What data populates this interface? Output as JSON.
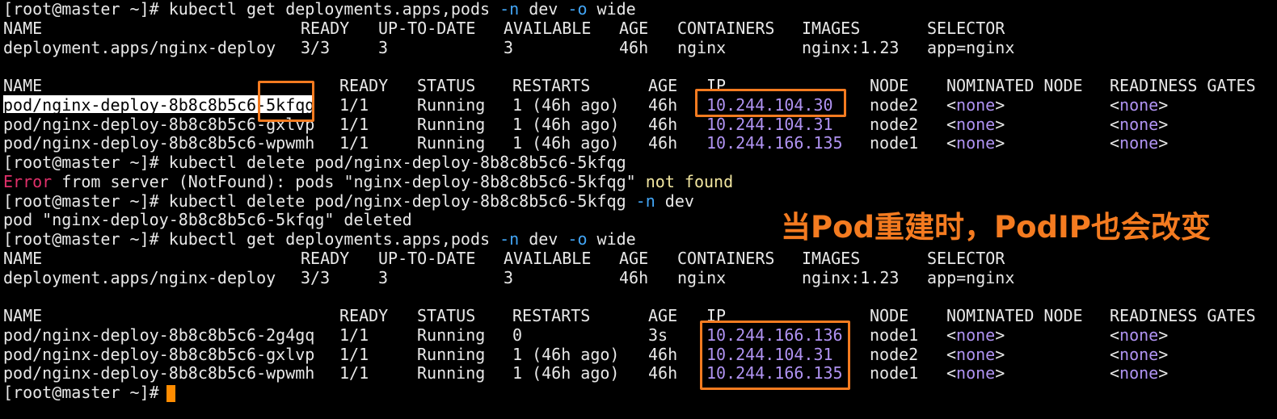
{
  "lines": [
    {
      "segs": [
        {
          "t": "[root@master ~]# kubectl get deployments.apps,pods "
        },
        {
          "t": "-n",
          "c": "blue"
        },
        {
          "t": " dev "
        },
        {
          "t": "-o",
          "c": "blue"
        },
        {
          "t": " wide"
        }
      ]
    },
    {
      "cols": [
        "NAME",
        "READY",
        "UP-TO-DATE",
        "AVAILABLE",
        "AGE",
        "CONTAINERS",
        "IMAGES",
        "SELECTOR"
      ]
    },
    {
      "cols": [
        "deployment.apps/nginx-deploy",
        "3/3",
        "3",
        "3",
        "46h",
        "nginx",
        "nginx:1.23",
        "app=nginx"
      ]
    },
    {
      "empty": true
    },
    {
      "cols": [
        "NAME",
        "READY",
        "STATUS",
        "RESTARTS",
        "AGE",
        "IP",
        "NODE",
        "NOMINATED NODE",
        "READINESS GATES"
      ]
    },
    {
      "cols": [
        "pod/nginx-deploy-8b8c8b5c6-5kfqg",
        "1/1",
        "Running",
        "1 (46h ago)",
        "46h",
        "10.244.104.30",
        "node2",
        "<none>",
        "<none>"
      ],
      "hl": true
    },
    {
      "cols": [
        "pod/nginx-deploy-8b8c8b5c6-gxlvp",
        "1/1",
        "Running",
        "1 (46h ago)",
        "46h",
        "10.244.104.31",
        "node2",
        "<none>",
        "<none>"
      ]
    },
    {
      "cols": [
        "pod/nginx-deploy-8b8c8b5c6-wpwmh",
        "1/1",
        "Running",
        "1 (46h ago)",
        "46h",
        "10.244.166.135",
        "node1",
        "<none>",
        "<none>"
      ]
    },
    {
      "segs": [
        {
          "t": "[root@master ~]# kubectl delete pod/nginx-deploy-8b8c8b5c6-5kfqg"
        }
      ]
    },
    {
      "segs": [
        {
          "t": "Error",
          "c": "red"
        },
        {
          "t": " from server (NotFound): pods \"nginx-deploy-8b8c8b5c6-5kfqg\" "
        },
        {
          "t": "not found",
          "c": "yellow"
        }
      ]
    },
    {
      "segs": [
        {
          "t": "[root@master ~]# kubectl delete pod/nginx-deploy-8b8c8b5c6-5kfqg "
        },
        {
          "t": "-n",
          "c": "blue"
        },
        {
          "t": " dev"
        }
      ]
    },
    {
      "segs": [
        {
          "t": "pod \"nginx-deploy-8b8c8b5c6-5kfqg\" deleted"
        }
      ]
    },
    {
      "segs": [
        {
          "t": "[root@master ~]# kubectl get deployments.apps,pods "
        },
        {
          "t": "-n",
          "c": "blue"
        },
        {
          "t": " dev "
        },
        {
          "t": "-o",
          "c": "blue"
        },
        {
          "t": " wide"
        }
      ]
    },
    {
      "cols": [
        "NAME",
        "READY",
        "UP-TO-DATE",
        "AVAILABLE",
        "AGE",
        "CONTAINERS",
        "IMAGES",
        "SELECTOR"
      ]
    },
    {
      "cols": [
        "deployment.apps/nginx-deploy",
        "3/3",
        "3",
        "3",
        "46h",
        "nginx",
        "nginx:1.23",
        "app=nginx"
      ]
    },
    {
      "empty": true
    },
    {
      "cols": [
        "NAME",
        "READY",
        "STATUS",
        "RESTARTS",
        "AGE",
        "IP",
        "NODE",
        "NOMINATED NODE",
        "READINESS GATES"
      ]
    },
    {
      "cols": [
        "pod/nginx-deploy-8b8c8b5c6-2g4gq",
        "1/1",
        "Running",
        "0",
        "3s",
        "10.244.166.136",
        "node1",
        "<none>",
        "<none>"
      ]
    },
    {
      "cols": [
        "pod/nginx-deploy-8b8c8b5c6-gxlvp",
        "1/1",
        "Running",
        "1 (46h ago)",
        "46h",
        "10.244.104.31",
        "node2",
        "<none>",
        "<none>"
      ]
    },
    {
      "cols": [
        "pod/nginx-deploy-8b8c8b5c6-wpwmh",
        "1/1",
        "Running",
        "1 (46h ago)",
        "46h",
        "10.244.166.135",
        "node1",
        "<none>",
        "<none>"
      ]
    },
    {
      "segs": [
        {
          "t": "[root@master ~]# "
        }
      ],
      "cursor": true
    }
  ],
  "annotation": "当Pod重建时，PodIP也会改变",
  "colors": {
    "accent": "#f47b20",
    "ip": "#b093f2",
    "flag": "#42a5f5",
    "error": "#e0306a",
    "warn": "#f2e6a0",
    "cursor": "#ff8c00"
  }
}
